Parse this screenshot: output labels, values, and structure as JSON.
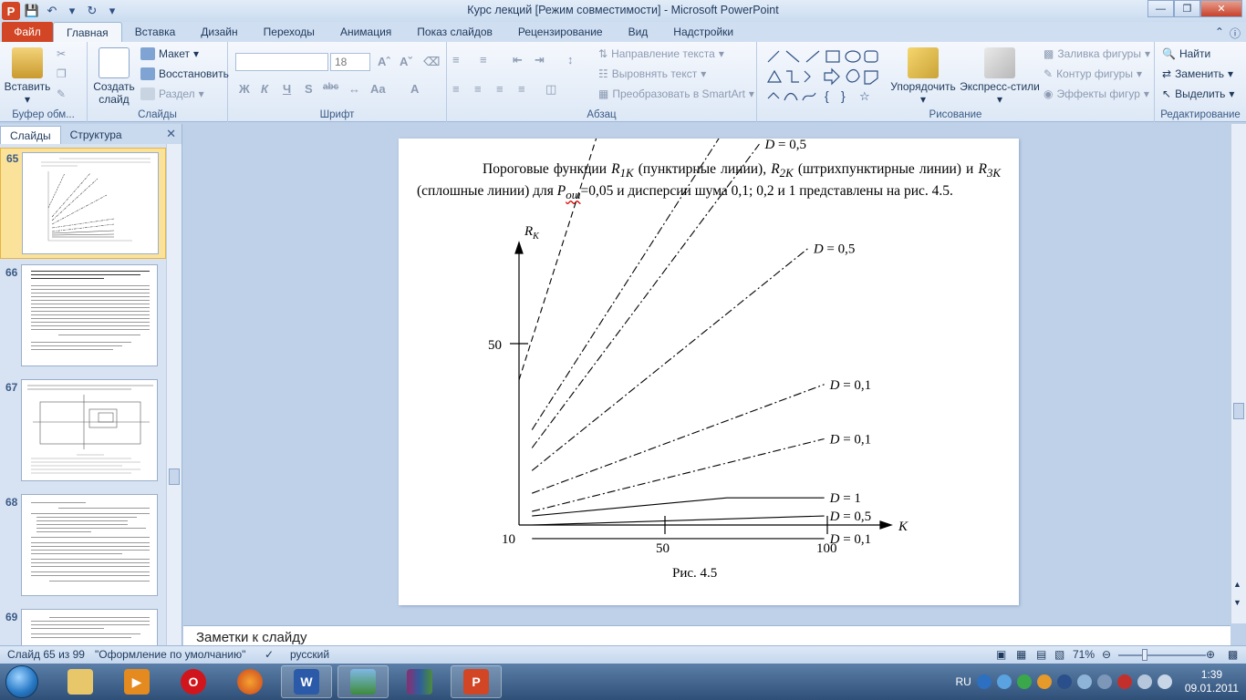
{
  "window": {
    "title": "Курс лекций [Режим совместимости]  -  Microsoft PowerPoint"
  },
  "tabs": [
    "Файл",
    "Главная",
    "Вставка",
    "Дизайн",
    "Переходы",
    "Анимация",
    "Показ слайдов",
    "Рецензирование",
    "Вид",
    "Надстройки"
  ],
  "ribbon": {
    "clipboard": {
      "label": "Буфер обм...",
      "paste": "Вставить"
    },
    "slides": {
      "label": "Слайды",
      "new_slide": "Создать слайд",
      "layout": "Макет",
      "reset": "Восстановить",
      "section": "Раздел"
    },
    "font": {
      "label": "Шрифт",
      "font_name": "",
      "font_size": "18",
      "bold": "Ж",
      "italic": "К",
      "underline": "Ч",
      "strike": "S",
      "spacing": "abc",
      "case": "Aa",
      "clear": "A"
    },
    "paragraph": {
      "label": "Абзац",
      "text_direction": "Направление текста",
      "align_text": "Выровнять текст",
      "smartart": "Преобразовать в SmartArt"
    },
    "drawing": {
      "label": "Рисование",
      "arrange": "Упорядочить",
      "quick_styles": "Экспресс-стили",
      "shape_fill": "Заливка фигуры",
      "shape_outline": "Контур фигуры",
      "shape_effects": "Эффекты фигур"
    },
    "editing": {
      "label": "Редактирование",
      "find": "Найти",
      "replace": "Заменить",
      "select": "Выделить"
    }
  },
  "left_panel": {
    "tabs": [
      "Слайды",
      "Структура"
    ],
    "slides": [
      {
        "num": "65",
        "selected": true
      },
      {
        "num": "66",
        "selected": false
      },
      {
        "num": "67",
        "selected": false
      },
      {
        "num": "68",
        "selected": false
      },
      {
        "num": "69",
        "selected": false
      }
    ]
  },
  "slide": {
    "p_text_1": "Пороговые функции ",
    "p_r1k": "R",
    "p_r1k_sub": "1K",
    "p_text_2": " (пунктирные линии), ",
    "p_r2k": "R",
    "p_r2k_sub": "2K",
    "p_text_3": " (штрихпунктирные линии) и ",
    "p_r3k": "R",
    "p_r3k_sub": "3K",
    "p_text_4": " (сплошные линии) для ",
    "p_posh": "P",
    "p_posh_sub": "ош",
    "p_text_5": "=0,05 и дисперсии шума 0,1; 0,2 и 1  представлены на рис.  4.5.",
    "caption": "Рис. 4.5"
  },
  "chart_data": {
    "type": "line",
    "title": "",
    "ylabel": "R_K",
    "xlabel": "K",
    "xlim": [
      10,
      100
    ],
    "ylim": [
      10,
      100
    ],
    "x_ticks": [
      "10",
      "50",
      "100"
    ],
    "y_ticks": [
      "50"
    ],
    "series": [
      {
        "name": "D = 1",
        "style": "dashed",
        "x": [
          10,
          35
        ],
        "y": [
          42,
          98
        ]
      },
      {
        "name": "D = 1",
        "style": "dashdot",
        "x": [
          14,
          74
        ],
        "y": [
          31,
          98
        ]
      },
      {
        "name": "D = 0,5",
        "style": "dashdot",
        "x": [
          14,
          84
        ],
        "y": [
          27,
          94
        ]
      },
      {
        "name": "D = 0,5",
        "style": "dashdot",
        "x": [
          14,
          99
        ],
        "y": [
          22,
          71
        ]
      },
      {
        "name": "D = 0,1",
        "style": "dashdot",
        "x": [
          14,
          104
        ],
        "y": [
          17,
          41
        ]
      },
      {
        "name": "D = 0,1",
        "style": "dashdot",
        "x": [
          14,
          104
        ],
        "y": [
          13,
          29
        ]
      },
      {
        "name": "D = 1",
        "style": "solid",
        "x": [
          14,
          74,
          104
        ],
        "y": [
          12,
          16,
          16
        ]
      },
      {
        "name": "D = 0,5",
        "style": "solid",
        "x": [
          14,
          104
        ],
        "y": [
          10,
          12
        ]
      },
      {
        "name": "D = 0,1",
        "style": "solid",
        "x": [
          14,
          104
        ],
        "y": [
          7,
          7
        ]
      }
    ]
  },
  "notes": {
    "placeholder": "Заметки к слайду"
  },
  "statusbar": {
    "slide_info": "Слайд 65 из 99",
    "theme": "\"Оформление по умолчанию\"",
    "language": "русский",
    "zoom": "71%"
  },
  "taskbar": {
    "lang": "RU",
    "time": "1:39",
    "date": "09.01.2011"
  }
}
